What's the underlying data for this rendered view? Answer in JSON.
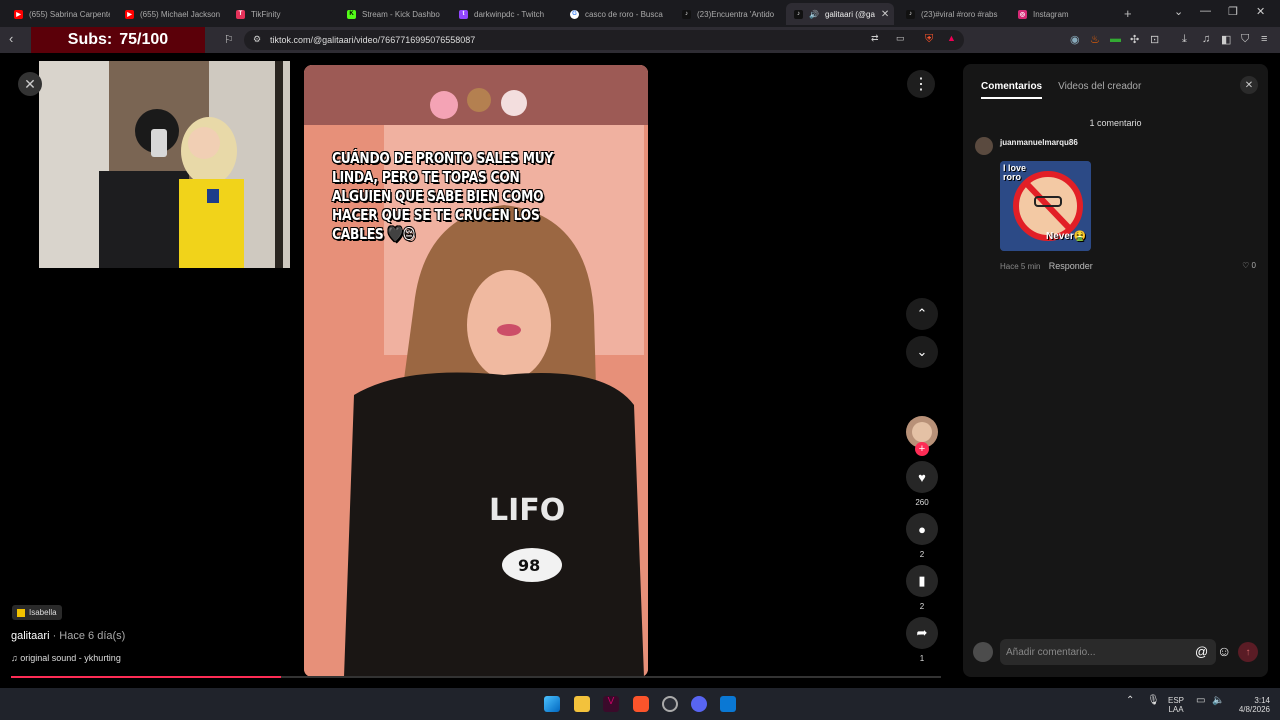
{
  "browser": {
    "tabs": [
      {
        "title": "(655) Sabrina Carpente",
        "icon": "youtube-icon",
        "color": "#ff0000"
      },
      {
        "title": "(655) Michael Jackson",
        "icon": "youtube-icon",
        "color": "#ff0000"
      },
      {
        "title": "TikFinity",
        "icon": "tikfinity-icon",
        "color": "#e5325a"
      },
      {
        "title": "Stream - Kick Dashbo",
        "icon": "kick-icon",
        "color": "#53fc18"
      },
      {
        "title": "darkwinpdc - Twitch",
        "icon": "twitch-icon",
        "color": "#9146ff"
      },
      {
        "title": "casco de roro - Busca",
        "icon": "google-icon",
        "color": "#ffffff"
      },
      {
        "title": "(23)Encuentra 'Antido",
        "icon": "tiktok-icon",
        "color": "#111111"
      },
      {
        "title": "galitaari (@ga",
        "icon": "tiktok-icon",
        "color": "#111111"
      },
      {
        "title": "(23)#viral #roro #rabs",
        "icon": "tiktok-icon",
        "color": "#111111"
      },
      {
        "title": "Instagram",
        "icon": "instagram-icon",
        "color": "#d62976"
      }
    ],
    "url": "tiktok.com/@galitaari/video/7667716995076558087",
    "subs_label": "Subs:",
    "subs_value": "75/100"
  },
  "video": {
    "caption": "CUÁNDO DE PRONTO SALES MUY LINDA, PERO TE TOPAS CON ALGUIEN QUE SABE BIEN COMO HACER QUE SE TE CRUCEN LOS CABLES 🖤😔",
    "badge": "Isabella",
    "author": "galitaari",
    "posted": " · Hace 6 día(s)",
    "sound": "original sound - ykhurting",
    "likes": "260",
    "comments": "2",
    "saves": "2",
    "shares": "1",
    "progress": 0.29
  },
  "comments_panel": {
    "tab_comments": "Comentarios",
    "tab_creator_videos": "Videos del creador",
    "count_label": "1 comentario",
    "comment": {
      "user": "juanmanuelmarqu86",
      "time": "Hace 5 min",
      "reply": "Responder",
      "likes": "0",
      "sticker_text_top": "I love roro",
      "sticker_text_bottom": "Never🤮"
    },
    "input_placeholder": "Añadir comentario..."
  },
  "taskbar": {
    "lang_top": "ESP",
    "lang_bottom": "LAA",
    "time": "3:14",
    "date": "4/8/2026"
  }
}
